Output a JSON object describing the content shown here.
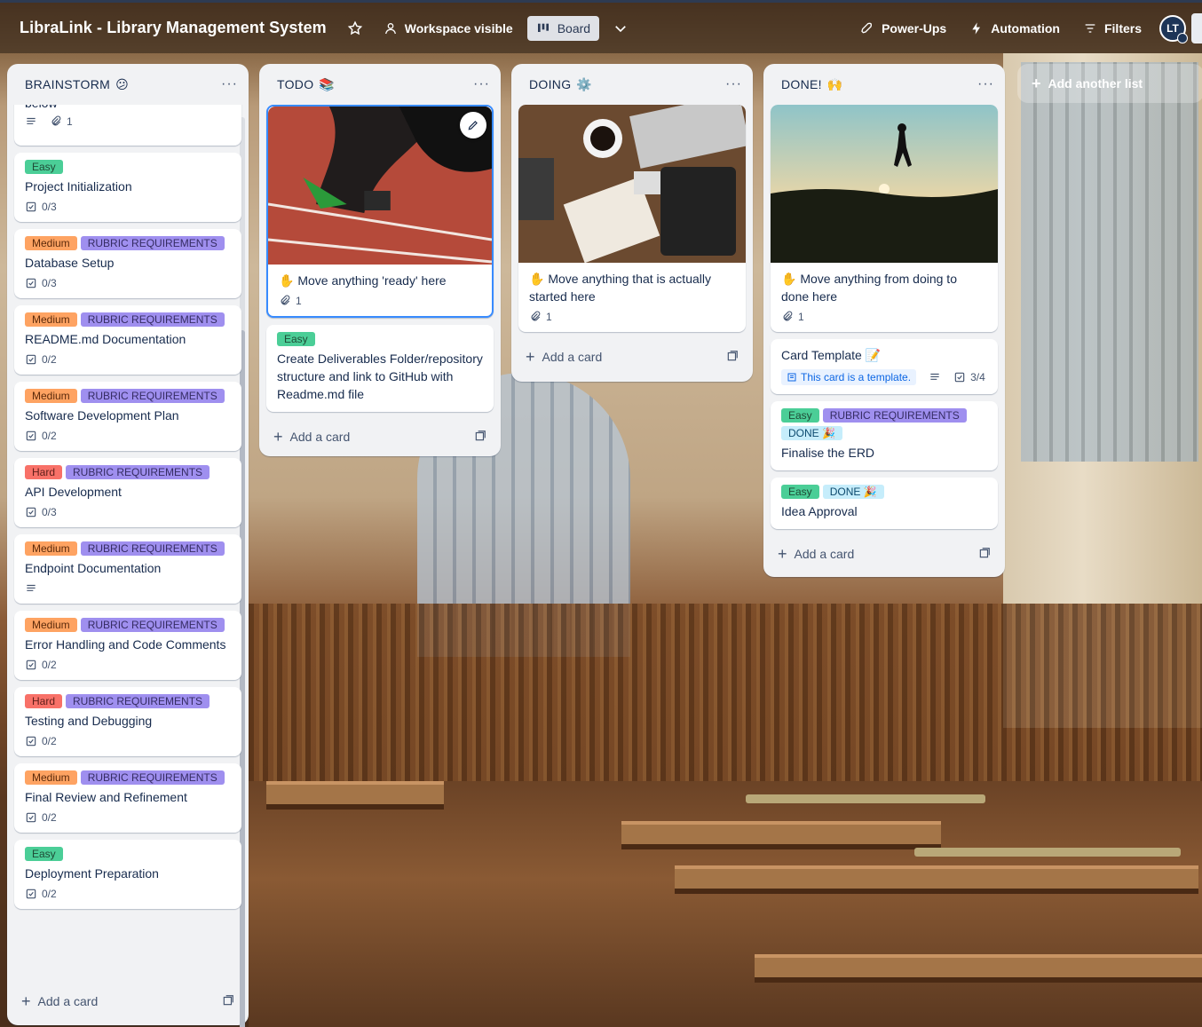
{
  "header": {
    "board_title": "LibraLink - Library Management System",
    "visibility_label": "Workspace visible",
    "view_label": "Board",
    "powerups_label": "Power-Ups",
    "automation_label": "Automation",
    "filters_label": "Filters",
    "avatar_initials": "LT"
  },
  "lists": {
    "brainstorm": {
      "title": "BRAINSTORM",
      "emoji": "😕",
      "partial_card_text": "below",
      "partial_attachments": "1",
      "cards": [
        {
          "labels": [
            "Easy"
          ],
          "title": "Project Initialization",
          "checklist": "0/3"
        },
        {
          "labels": [
            "Medium",
            "RUBRIC REQUIREMENTS"
          ],
          "title": "Database Setup",
          "checklist": "0/3"
        },
        {
          "labels": [
            "Medium",
            "RUBRIC REQUIREMENTS"
          ],
          "title": "README.md Documentation",
          "checklist": "0/2"
        },
        {
          "labels": [
            "Medium",
            "RUBRIC REQUIREMENTS"
          ],
          "title": "Software Development Plan",
          "checklist": "0/2"
        },
        {
          "labels": [
            "Hard",
            "RUBRIC REQUIREMENTS"
          ],
          "title": "API Development",
          "checklist": "0/3"
        },
        {
          "labels": [
            "Medium",
            "RUBRIC REQUIREMENTS"
          ],
          "title": "Endpoint Documentation",
          "checklist": ""
        },
        {
          "labels": [
            "Medium",
            "RUBRIC REQUIREMENTS"
          ],
          "title": "Error Handling and Code Comments",
          "checklist": "0/2"
        },
        {
          "labels": [
            "Hard",
            "RUBRIC REQUIREMENTS"
          ],
          "title": "Testing and Debugging",
          "checklist": "0/2"
        },
        {
          "labels": [
            "Medium",
            "RUBRIC REQUIREMENTS"
          ],
          "title": "Final Review and Refinement",
          "checklist": "0/2"
        },
        {
          "labels": [
            "Easy"
          ],
          "title": "Deployment Preparation",
          "checklist": "0/2"
        }
      ],
      "add_card_label": "Add a card"
    },
    "todo": {
      "title": "TODO",
      "emoji": "📚",
      "cover_card": {
        "title": "Move anything 'ready' here",
        "attachments": "1"
      },
      "card2": {
        "label": "Easy",
        "title": "Create Deliverables Folder/repository structure and link to GitHub with Readme.md file"
      },
      "add_card_label": "Add a card"
    },
    "doing": {
      "title": "DOING",
      "emoji": "⚙️",
      "cover_card": {
        "title": "Move anything that is actually started here",
        "attachments": "1"
      },
      "add_card_label": "Add a card"
    },
    "done": {
      "title": "DONE!",
      "emoji": "🙌",
      "cover_card": {
        "title": "Move anything from doing to done here",
        "attachments": "1"
      },
      "template_card": {
        "title": "Card Template",
        "emoji": "📝",
        "template_badge": "This card is a template.",
        "checklist": "3/4"
      },
      "erd_card": {
        "labels": [
          "Easy",
          "RUBRIC REQUIREMENTS",
          "DONE 🎉"
        ],
        "title": "Finalise the ERD"
      },
      "idea_card": {
        "labels": [
          "Easy",
          "DONE 🎉"
        ],
        "title": "Idea Approval"
      },
      "add_card_label": "Add a card"
    }
  },
  "add_list_label": "Add another list",
  "colors": {
    "easy": "#4bce97",
    "medium": "#fea362",
    "hard": "#f87168",
    "rubric": "#9f8fef",
    "done": "#c6edfb"
  }
}
